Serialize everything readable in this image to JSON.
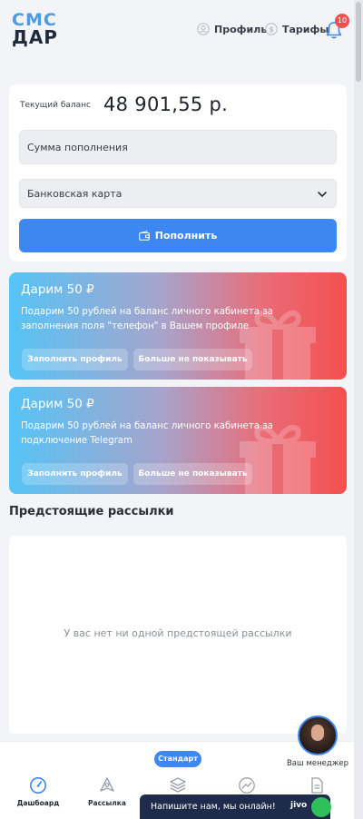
{
  "header": {
    "logo_top": "СМС",
    "logo_bottom": "ДАР",
    "profile_label": "Профиль",
    "tariffs_label": "Тарифы",
    "notifications_count": "10"
  },
  "balance": {
    "label": "Текущий баланс",
    "value": "48 901,55 р.",
    "amount_placeholder": "Сумма пополнения",
    "payment_method": "Банковская карта",
    "topup_button": "Пополнить"
  },
  "promos": [
    {
      "title": "Дарим 50 ₽",
      "text": "Подарим 50 рублей на баланс личного кабинета за заполнения поля \"телефон\" в Вашем профиле",
      "fill_button": "Заполнить профиль",
      "hide_button": "Больше не показывать"
    },
    {
      "title": "Дарим 50 ₽",
      "text": "Подарим 50 рублей на баланс личного кабинета за подключение Telegram",
      "fill_button": "Заполнить профиль",
      "hide_button": "Больше не показывать"
    }
  ],
  "upcoming": {
    "title": "Предстоящие рассылки",
    "empty_message": "У вас нет ни одной предстоящей рассылки"
  },
  "bottom_nav": {
    "plan_badge": "Стандарт",
    "items": [
      {
        "label": "Дашбоард",
        "icon": "speedometer-icon"
      },
      {
        "label": "Рассылка",
        "icon": "send-icon"
      },
      {
        "label": "",
        "icon": "layers-icon"
      },
      {
        "label": "",
        "icon": "stats-icon"
      },
      {
        "label": "ты",
        "icon": "document-icon"
      }
    ]
  },
  "manager": {
    "label": "Ваш менеджер"
  },
  "chat_widget": {
    "text": "Напишите нам, мы онлайн!",
    "brand": "jivo"
  },
  "colors": {
    "accent": "#3d88f0",
    "badge": "#ef4f4f",
    "promo_gradient_start": "#55c4f6",
    "promo_gradient_end": "#f44f4f",
    "chat_bg": "#1f2b4a"
  }
}
